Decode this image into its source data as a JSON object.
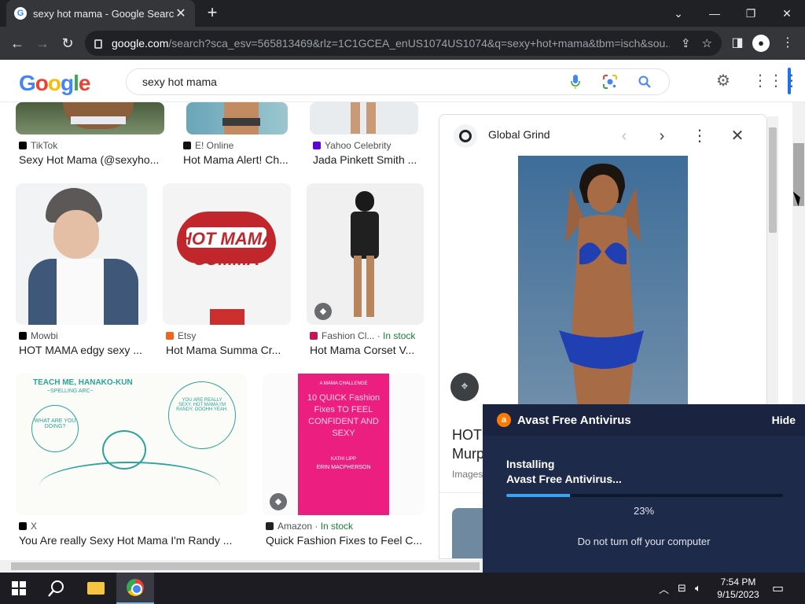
{
  "browser": {
    "tab_title": "sexy hot mama - Google Search",
    "tab_close": "✕",
    "new_tab": "+",
    "url_host": "google.com",
    "url_rest": "/search?sca_esv=565813469&rlz=1C1GCEA_enUS1074US1074&q=sexy+hot+mama&tbm=isch&sou...",
    "window_controls": [
      "⌄",
      "—",
      "❐",
      "✕"
    ]
  },
  "google": {
    "logo_letters": [
      "G",
      "o",
      "o",
      "g",
      "l",
      "e"
    ],
    "logo_colors": [
      "#4285f4",
      "#ea4335",
      "#fbbc05",
      "#4285f4",
      "#34a853",
      "#ea4335"
    ],
    "query": "sexy hot mama"
  },
  "results": [
    {
      "source": "TikTok",
      "title": "Sexy Hot Mama (@sexyho...",
      "fav_color": "#000000"
    },
    {
      "source": "E! Online",
      "title": "Hot Mama Alert! Ch...",
      "fav_color": "#111111"
    },
    {
      "source": "Yahoo Celebrity",
      "title": "Jada Pinkett Smith ...",
      "fav_color": "#6001d2"
    },
    {
      "source": "Mowbi",
      "title": "HOT MAMA edgy sexy ...",
      "fav_color": "#000000"
    },
    {
      "source": "Etsy",
      "title": "Hot Mama Summa Cr...",
      "fav_color": "#f1641e"
    },
    {
      "source": "Fashion Cl...",
      "stock": "· In stock",
      "title": "Hot Mama Corset V...",
      "fav_color": "#c2185b"
    },
    {
      "source": "X",
      "title": "You Are really Sexy Hot Mama I'm Randy ...",
      "fav_color": "#000000"
    },
    {
      "source": "Amazon",
      "stock": "· In stock",
      "title": "Quick Fashion Fixes to Feel C...",
      "fav_color": "#222222"
    }
  ],
  "comic": {
    "header_line1": "TEACH ME, HANAKO-KUN",
    "header_line2": "~SPELLING ARC~",
    "bubble_left": "WHAT ARE YOU DOING?",
    "bubble_right": "YOU ARE REALLY SEXY, HOT MAMA I'M RANDY. OOOHH YEAH."
  },
  "book": {
    "top": "A MAMA CHALLENGE",
    "title": "10 QUICK Fashion Fixes TO FEEL CONFIDENT AND SEXY",
    "author1": "KATHI LIPP",
    "author2": "ERIN MACPHERSON"
  },
  "tshirt": {
    "text": "HOT MAMA SUMMA"
  },
  "panel": {
    "site": "Global Grind",
    "title": "HOT Murp",
    "subtitle": "Images"
  },
  "avast": {
    "title": "Avast Free Antivirus",
    "hide": "Hide",
    "status_line1": "Installing",
    "status_line2": "Avast Free Antivirus...",
    "progress": 0.23,
    "percent": "23%",
    "note": "Do not turn off your computer"
  },
  "taskbar": {
    "time": "7:54 PM",
    "date": "9/15/2023"
  }
}
